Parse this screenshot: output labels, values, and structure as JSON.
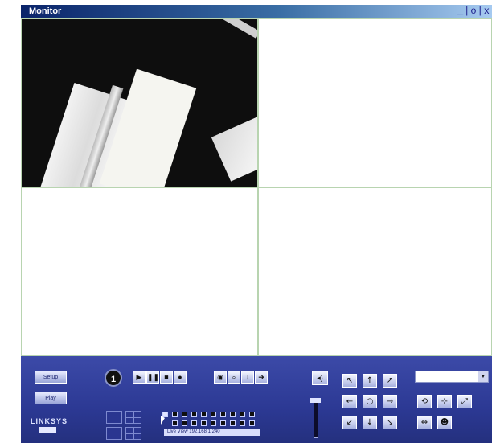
{
  "window": {
    "title": "Monitor",
    "controls": "_|o|x"
  },
  "left_buttons": {
    "setup_label": "Setup",
    "play_label": "Play"
  },
  "logo": {
    "text": "LINKSYS"
  },
  "channel": {
    "number": "1"
  },
  "playback_icons": [
    "play-icon",
    "pause-icon",
    "stop-icon",
    "record-icon"
  ],
  "tool_icons": [
    "snapshot-icon",
    "zoom-icon",
    "download-icon",
    "forward-icon"
  ],
  "ptz_icons": [
    "arrow-up-left",
    "arrow-up",
    "arrow-up-right",
    "arrow-left",
    "ptz-home",
    "arrow-right",
    "arrow-down-left",
    "arrow-down",
    "arrow-down-right"
  ],
  "status_text": "Live View  192.168.1.240",
  "preset": {
    "value": ""
  },
  "colors": {
    "panel": "#2c3994",
    "titlebar": "#0a246a"
  }
}
